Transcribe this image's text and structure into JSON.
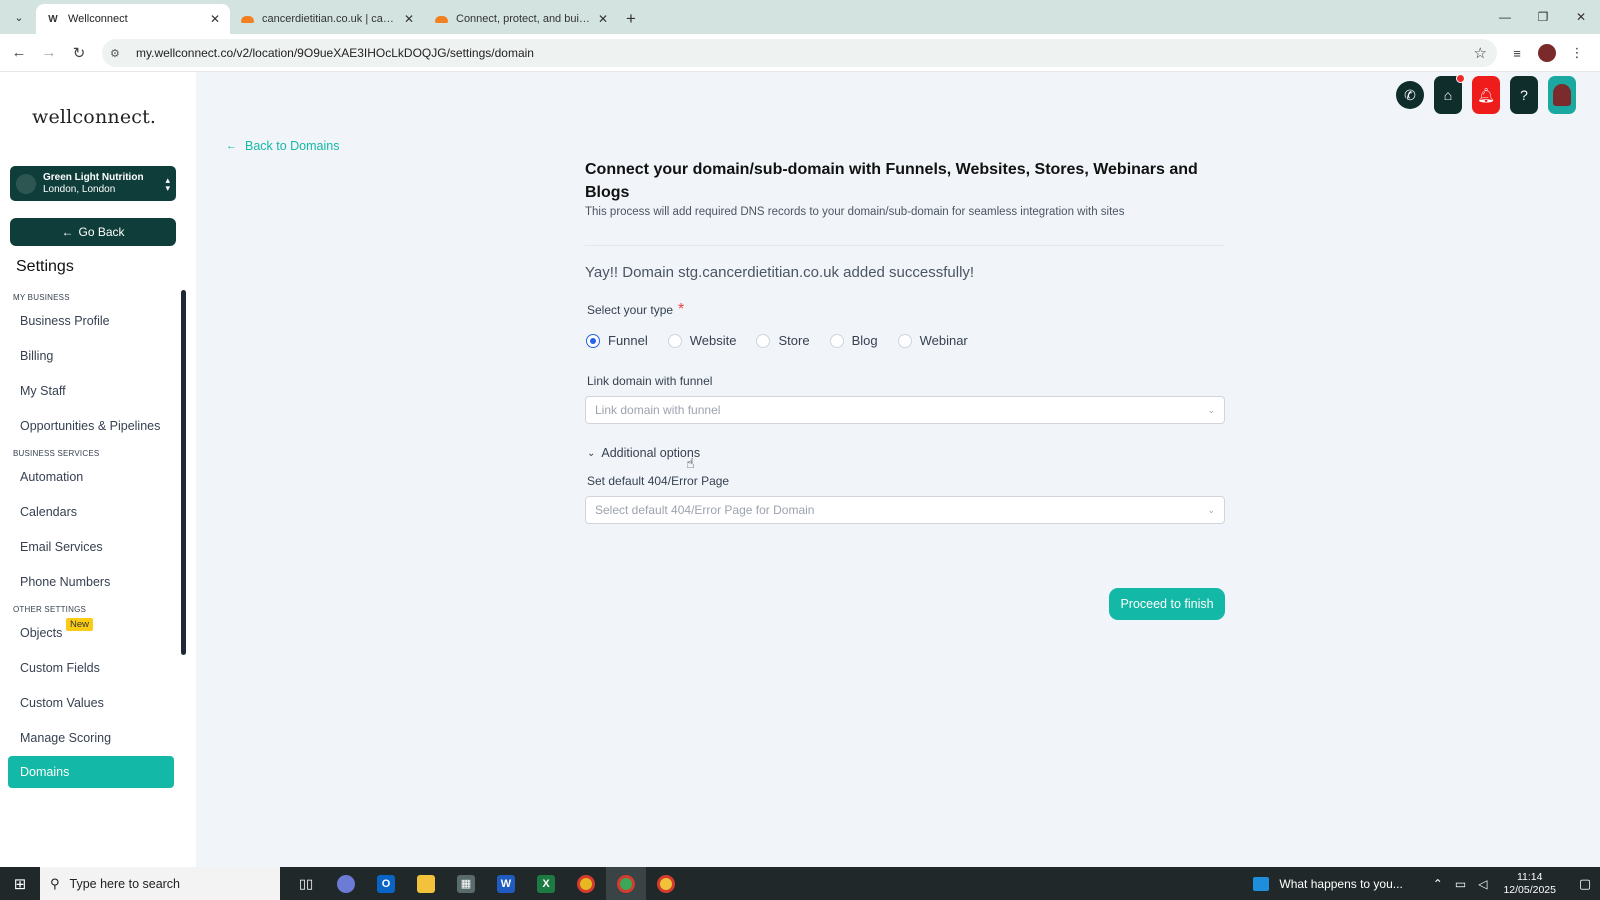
{
  "browser": {
    "tabs": [
      {
        "title": "Wellconnect",
        "active": true,
        "favicon": "wellconnect-icon"
      },
      {
        "title": "cancerdietitian.co.uk | cancerdietitian",
        "active": false,
        "favicon": "cloudflare-icon"
      },
      {
        "title": "Connect, protect, and build everywhere",
        "active": false,
        "favicon": "cloudflare-icon"
      }
    ],
    "url": "my.wellconnect.co/v2/location/9O9ueXAE3IHOcLkDOQJG/settings/domain"
  },
  "sidebar": {
    "logo": "wellconnect.",
    "location": {
      "name": "Green Light Nutrition",
      "city": "London, London"
    },
    "go_back": "Go Back",
    "title": "Settings",
    "sections": [
      {
        "label": "MY BUSINESS",
        "items": [
          "Business Profile",
          "Billing",
          "My Staff",
          "Opportunities & Pipelines"
        ]
      },
      {
        "label": "BUSINESS SERVICES",
        "items": [
          "Automation",
          "Calendars",
          "Email Services",
          "Phone Numbers"
        ]
      },
      {
        "label": "OTHER SETTINGS",
        "items": [
          "Objects",
          "Custom Fields",
          "Custom Values",
          "Manage Scoring",
          "Domains"
        ]
      }
    ],
    "objects_badge": "New",
    "active_item": "Domains"
  },
  "main": {
    "back_link": "Back to Domains",
    "heading": "Connect your domain/sub-domain with Funnels, Websites, Stores, Webinars and Blogs",
    "subheading": "This process will add required DNS records to your domain/sub-domain for seamless integration with sites",
    "success": "Yay!! Domain stg.cancerdietitian.co.uk added successfully!",
    "type_label": "Select your type",
    "type_required": "*",
    "types": [
      "Funnel",
      "Website",
      "Store",
      "Blog",
      "Webinar"
    ],
    "selected_type": "Funnel",
    "link_label": "Link domain with funnel",
    "link_placeholder": "Link domain with funnel",
    "additional_options": "Additional options",
    "error_page_label": "Set default 404/Error Page",
    "error_page_placeholder": "Select default 404/Error Page for Domain",
    "proceed": "Proceed to finish"
  },
  "taskbar": {
    "search_placeholder": "Type here to search",
    "news": "What happens to you...",
    "time": "11:14",
    "date": "12/05/2025"
  },
  "colors": {
    "accent": "#14b8a6",
    "dark_green": "#0f3d3a",
    "alert_red": "#ef1c1c"
  }
}
